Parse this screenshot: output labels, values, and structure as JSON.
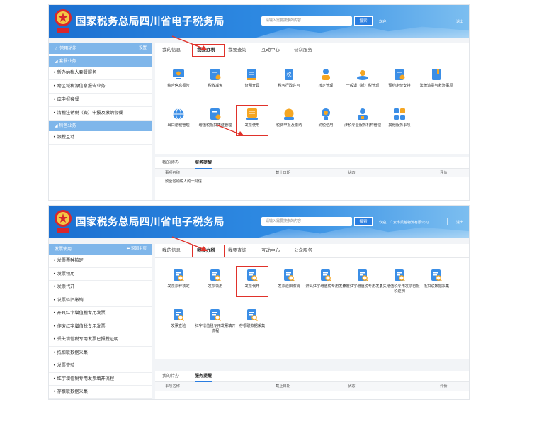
{
  "header": {
    "title": "国家税务总局四川省电子税务局",
    "search_placeholder": "请输入需要搜索的内容",
    "search_button": "搜索",
    "welcome": "欢迎，",
    "welcome_2": "欢迎，广安市凯越物流有限公司...",
    "logout": "退出",
    "emblem_text": "中国税务"
  },
  "screen1": {
    "sidebar": {
      "common_label": "常用功能",
      "settings_label": "设置",
      "group1": "套餐业务",
      "items1": [
        "新办纳税人套餐服务",
        "跨区域税源信息报告业务",
        "应申报套餐",
        "清税注销税（费）申报及缴纳套餐"
      ],
      "group2": "特色业务",
      "items2": [
        "银税互动"
      ]
    },
    "tabs": [
      "我的信息",
      "我要办税",
      "我要查询",
      "互动中心",
      "公众服务"
    ],
    "services": [
      {
        "label": "综合信息报告",
        "icon": "report-icon"
      },
      {
        "label": "税收减免",
        "icon": "tax-relief-icon"
      },
      {
        "label": "证明开具",
        "icon": "certificate-icon"
      },
      {
        "label": "税务行政许可",
        "icon": "permit-icon"
      },
      {
        "label": "核定管理",
        "icon": "verify-icon"
      },
      {
        "label": "一般退（抵）税管理",
        "icon": "refund-icon"
      },
      {
        "label": "预约定价安排",
        "icon": "pricing-icon"
      },
      {
        "label": "法律追责与救济事项",
        "icon": "law-book-icon"
      },
      {
        "label": "出口退税管理",
        "icon": "globe-icon"
      },
      {
        "label": "增值税抵扣凭证管理",
        "icon": "deduction-icon"
      },
      {
        "label": "发票使用",
        "icon": "invoice-icon"
      },
      {
        "label": "税费申报及缴纳",
        "icon": "declare-icon"
      },
      {
        "label": "纳税信用",
        "icon": "credit-icon"
      },
      {
        "label": "涉税专业服务机构管理",
        "icon": "agency-icon"
      },
      {
        "label": "其他服务事项",
        "icon": "apps-icon"
      }
    ],
    "panel": {
      "tabs": [
        "我的待办",
        "服务提醒"
      ],
      "columns": [
        "事项名称",
        "截止日期",
        "状态",
        "评价"
      ],
      "rows": [
        [
          "致全省纳税人的一封信",
          "",
          "",
          ""
        ]
      ]
    }
  },
  "screen2": {
    "sidebar": {
      "head_label": "发票使用",
      "back_label": "返回主页",
      "items": [
        "发票票种核定",
        "发票领用",
        "发票代开",
        "发票验旧缴销",
        "开具红字增值税专用发票",
        "作废红字增值税专用发票",
        "丢失增值税专用发票已报税证明",
        "抵扣联数据采集",
        "发票查验",
        "红字增值税专用发票填开流程",
        "存根联数据采集"
      ]
    },
    "tabs": [
      "我的信息",
      "我要办税",
      "我要查询",
      "互动中心",
      "公众服务"
    ],
    "services": [
      {
        "label": "发票票种核定",
        "icon": "invoice-search-icon"
      },
      {
        "label": "发票领用",
        "icon": "invoice-search-icon"
      },
      {
        "label": "发票代开",
        "icon": "invoice-search-icon"
      },
      {
        "label": "发票验旧缴销",
        "icon": "invoice-search-icon"
      },
      {
        "label": "开具红字增值税专用发票",
        "icon": "invoice-search-icon"
      },
      {
        "label": "作废红字增值税专用发票",
        "icon": "invoice-search-icon"
      },
      {
        "label": "丢失增值税专用发票已报税证明",
        "icon": "invoice-search-icon"
      },
      {
        "label": "抵扣联数据采集",
        "icon": "invoice-search-icon"
      },
      {
        "label": "发票查验",
        "icon": "invoice-search-icon"
      },
      {
        "label": "红字增值税专用发票填开流程",
        "icon": "invoice-search-icon"
      },
      {
        "label": "存根联数据采集",
        "icon": "invoice-search-icon"
      }
    ],
    "panel": {
      "tabs": [
        "我的待办",
        "服务提醒"
      ],
      "columns": [
        "事项名称",
        "截止日期",
        "状态",
        "评价"
      ]
    }
  },
  "colors": {
    "header_blue": "#1b6fd0",
    "accent_blue": "#2a7de0",
    "highlight_red": "#e0322b",
    "sidebar_head": "#7fb6ea",
    "icon_blue": "#3b8ee6",
    "icon_orange": "#f5a623"
  }
}
